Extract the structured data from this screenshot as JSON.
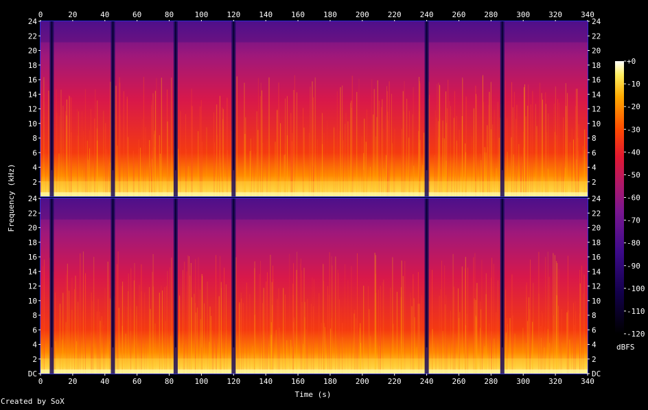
{
  "chart_data": {
    "type": "heatmap",
    "title": "",
    "xlabel": "Time (s)",
    "ylabel": "Frequency (kHz)",
    "xlim": [
      0,
      340
    ],
    "x_ticks": [
      "0",
      "20",
      "40",
      "60",
      "80",
      "100",
      "120",
      "140",
      "160",
      "180",
      "200",
      "220",
      "240",
      "260",
      "280",
      "300",
      "320",
      "340"
    ],
    "channels": [
      {
        "y_ticks": [
          "2",
          "4",
          "6",
          "8",
          "10",
          "12",
          "14",
          "16",
          "18",
          "20",
          "22",
          "24"
        ]
      },
      {
        "y_ticks": [
          "DC",
          "2",
          "4",
          "6",
          "8",
          "10",
          "12",
          "14",
          "16",
          "18",
          "20",
          "22",
          "24"
        ]
      }
    ],
    "ylim_khz": [
      0,
      24
    ],
    "colorbar": {
      "label": "dBFS",
      "ticks": [
        "+0",
        "-10",
        "-20",
        "-30",
        "-40",
        "-50",
        "-60",
        "-70",
        "-80",
        "-90",
        "-100",
        "-110",
        "-120"
      ],
      "range": [
        -120,
        0
      ]
    },
    "silent_gaps_s": [
      7,
      45,
      84,
      120,
      240,
      287
    ],
    "colors": {
      "background": "#000000",
      "frame": "#2b2bd8",
      "palette": [
        "#000000",
        "#1a0050",
        "#4a1090",
        "#8a1880",
        "#c81848",
        "#f01818",
        "#ff5a00",
        "#ffb400",
        "#fff060",
        "#ffffff"
      ]
    }
  },
  "footer": {
    "credit": "Created by SoX"
  }
}
